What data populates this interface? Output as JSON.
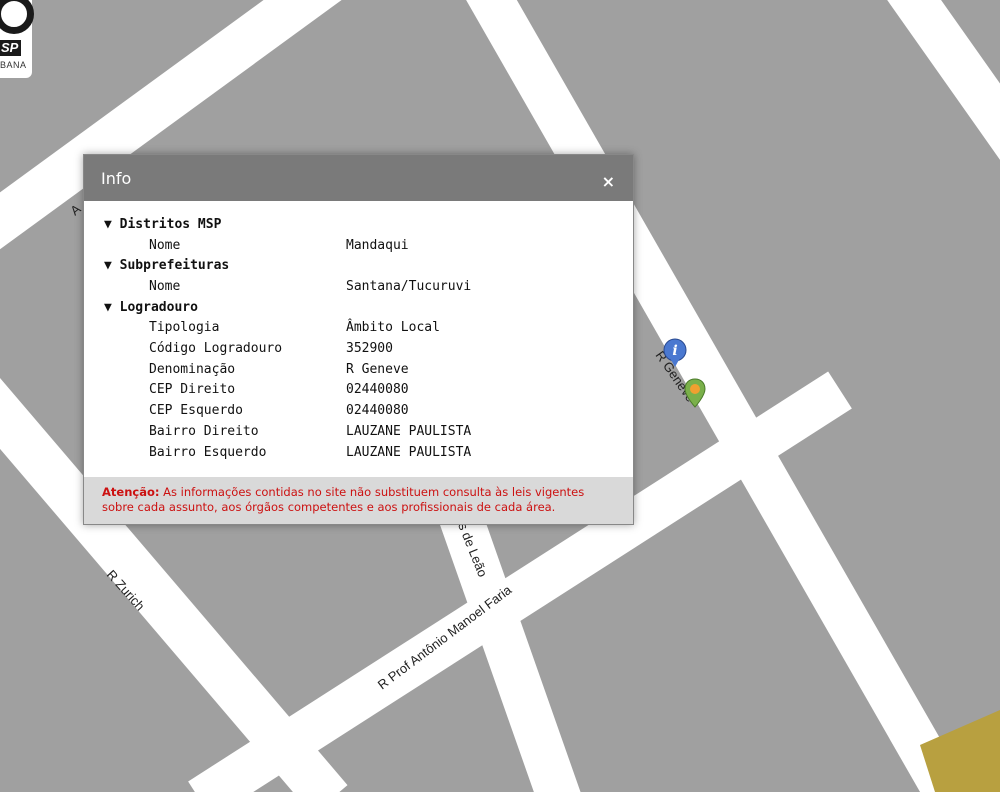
{
  "map": {
    "street_labels": [
      "R Zurich",
      "R Prof Antônio Manoel Faria",
      "s de Leão",
      "R Geneve",
      "A"
    ]
  },
  "logo": {
    "text": "SP",
    "subtext": "BANA"
  },
  "info": {
    "title": "Info",
    "close": "×",
    "sections": [
      {
        "heading": "▼ Distritos MSP",
        "rows": [
          {
            "label": "Nome",
            "value": "Mandaqui"
          }
        ]
      },
      {
        "heading": "▼ Subprefeituras",
        "rows": [
          {
            "label": "Nome",
            "value": "Santana/Tucuruvi"
          }
        ]
      },
      {
        "heading": "▼ Logradouro",
        "rows": [
          {
            "label": "Tipologia",
            "value": "Âmbito Local"
          },
          {
            "label": "Código Logradouro",
            "value": "352900"
          },
          {
            "label": "Denominação",
            "value": "R Geneve"
          },
          {
            "label": "CEP Direito",
            "value": "02440080"
          },
          {
            "label": "CEP Esquerdo",
            "value": "02440080"
          },
          {
            "label": "Bairro Direito",
            "value": "LAUZANE PAULISTA"
          },
          {
            "label": "Bairro Esquerdo",
            "value": "LAUZANE PAULISTA"
          }
        ]
      }
    ],
    "footer_bold": "Atenção:",
    "footer_text": " As informações contidas no site não substituem consulta às leis vigentes sobre cada assunto, aos órgãos competentes e aos profissionais de cada área."
  },
  "colors": {
    "block": "#a0a0a0",
    "road": "#ffffff",
    "highlight": "#b8a040",
    "warning": "#cc1111"
  }
}
